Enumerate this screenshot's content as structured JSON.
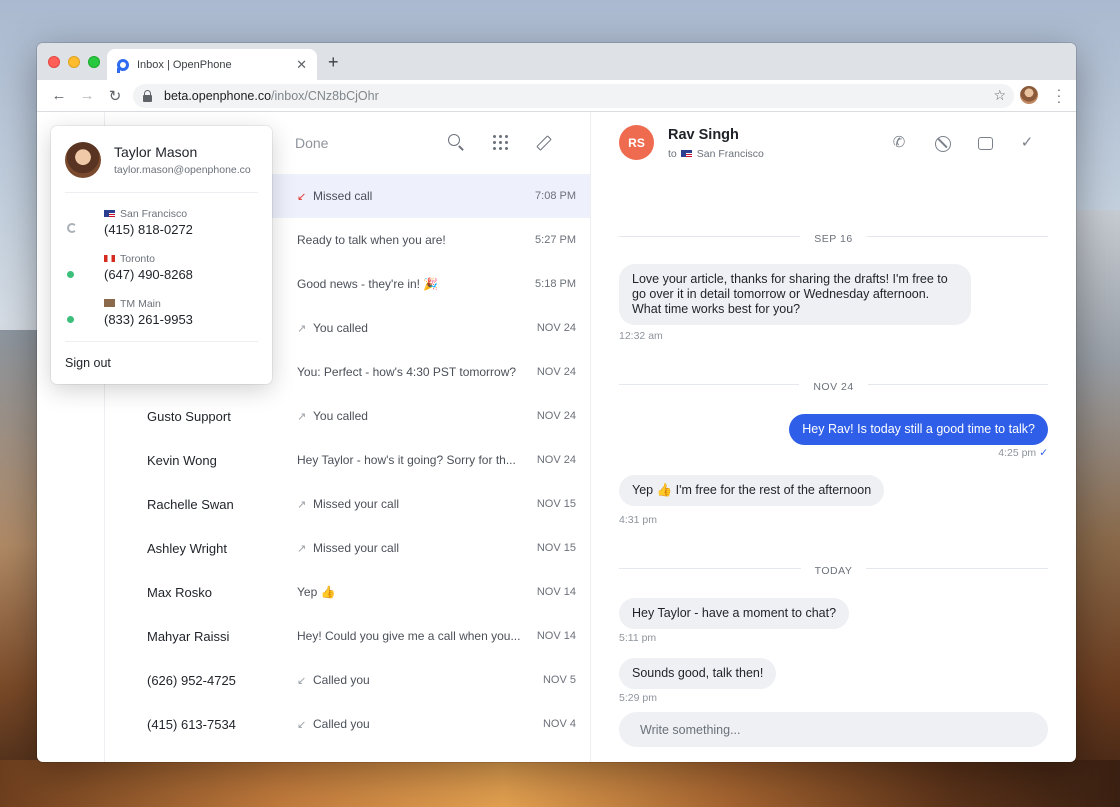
{
  "browser": {
    "tab_title": "Inbox | OpenPhone",
    "new_tab": "+",
    "url_host": "beta.openphone.co",
    "url_path": "/inbox/CNz8bCjOhr"
  },
  "list": {
    "header_label": "Done",
    "rows": [
      {
        "name": "",
        "preview": "Missed call",
        "time": "7:08 PM",
        "arrow": "↙",
        "arrow_color": "red"
      },
      {
        "name": "",
        "preview": "Ready to talk when you are!",
        "time": "5:27 PM",
        "arrow": ""
      },
      {
        "name": "",
        "preview": "Good news - they're in! 🎉",
        "time": "5:18 PM",
        "arrow": ""
      },
      {
        "name": "",
        "preview": "You called",
        "time": "NOV 24",
        "arrow": "↗"
      },
      {
        "name": "",
        "preview": "You: Perfect - how's 4:30 PST tomorrow?",
        "time": "NOV 24",
        "arrow": ""
      },
      {
        "name": "Gusto Support",
        "preview": "You called",
        "time": "NOV 24",
        "arrow": "↗"
      },
      {
        "name": "Kevin Wong",
        "preview": "Hey Taylor - how's it going? Sorry for th...",
        "time": "NOV 24",
        "arrow": ""
      },
      {
        "name": "Rachelle Swan",
        "preview": "Missed your call",
        "time": "NOV 15",
        "arrow": "↗"
      },
      {
        "name": "Ashley Wright",
        "preview": "Missed your call",
        "time": "NOV 15",
        "arrow": "↗"
      },
      {
        "name": "Max Rosko",
        "preview": "Yep 👍",
        "time": "NOV 14",
        "arrow": ""
      },
      {
        "name": "Mahyar Raissi",
        "preview": "Hey! Could you give me a call when you...",
        "time": "NOV 14",
        "arrow": ""
      },
      {
        "name": "(626) 952-4725",
        "preview": "Called you",
        "time": "NOV 5",
        "arrow": "↙"
      },
      {
        "name": "(415) 613-7534",
        "preview": "Called you",
        "time": "NOV 4",
        "arrow": "↙"
      }
    ]
  },
  "account": {
    "name": "Taylor Mason",
    "email": "taylor.mason@openphone.co",
    "lines": [
      {
        "location": "San Francisco",
        "number": "(415) 818-0272",
        "flag": "us",
        "status": "away"
      },
      {
        "location": "Toronto",
        "number": "(647) 490-8268",
        "flag": "ca",
        "status": "online"
      },
      {
        "location": "TM Main",
        "number": "(833) 261-9953",
        "flag": "bld",
        "status": "online"
      }
    ],
    "sign_out": "Sign out"
  },
  "chat": {
    "contact_initials": "RS",
    "contact_name": "Rav Singh",
    "to_label": "to",
    "to_location": "San Francisco",
    "day_sep_1": "SEP 16",
    "msg_1": "Love your article, thanks for sharing the drafts! I'm free to go over it in detail tomorrow or Wednesday afternoon. What time works best for you?",
    "msg_1_time": "12:32 am",
    "day_sep_2": "NOV 24",
    "msg_2": "Hey Rav! Is today still a good time to talk?",
    "msg_2_time": "4:25 pm",
    "msg_3": "Yep 👍  I'm free for the rest of the afternoon",
    "msg_3_time": "4:31 pm",
    "day_sep_3": "TODAY",
    "msg_4": "Hey Taylor - have a moment to chat?",
    "msg_4_time": "5:11 pm",
    "msg_5": "Sounds good, talk then!",
    "msg_5_time": "5:29 pm",
    "composer_placeholder": "Write something..."
  },
  "colors": {
    "accent": "#2f5ee8",
    "missed": "#e0342b",
    "avatar_rs": "#ef6b4f",
    "online": "#3bbf7b",
    "active_row": "#eef0fc"
  }
}
